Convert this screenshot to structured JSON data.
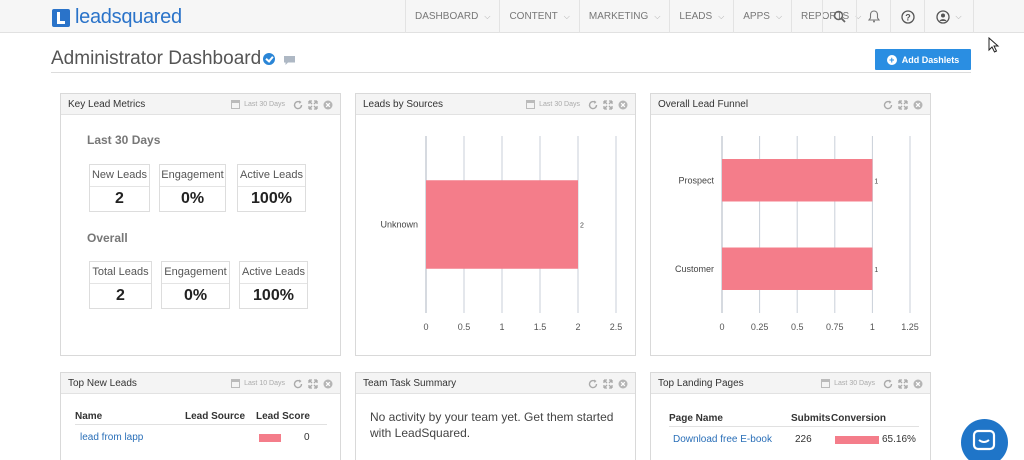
{
  "brand": {
    "name": "leadsquared"
  },
  "nav": {
    "items": [
      {
        "label": "DASHBOARD"
      },
      {
        "label": "CONTENT"
      },
      {
        "label": "MARKETING"
      },
      {
        "label": "LEADS"
      },
      {
        "label": "APPS"
      },
      {
        "label": "REPORTS"
      }
    ],
    "icons": [
      "search-icon",
      "bell-icon",
      "help-icon",
      "user-icon"
    ]
  },
  "page": {
    "title": "Administrator Dashboard",
    "add_button": "Add Dashlets"
  },
  "colors": {
    "accent": "#2a8ee2",
    "bar": "#f47d8a",
    "link": "#2a6fb8"
  },
  "dashlets": {
    "key_metrics": {
      "title": "Key Lead Metrics",
      "date": "Last 30 Days",
      "section1": {
        "heading": "Last 30 Days",
        "boxes": [
          {
            "label": "New Leads",
            "value": "2"
          },
          {
            "label": "Engagement",
            "value": "0%"
          },
          {
            "label": "Active Leads",
            "value": "100%"
          }
        ]
      },
      "section2": {
        "heading": "Overall",
        "boxes": [
          {
            "label": "Total Leads",
            "value": "2"
          },
          {
            "label": "Engagement",
            "value": "0%"
          },
          {
            "label": "Active Leads",
            "value": "100%"
          }
        ]
      }
    },
    "leads_by_sources": {
      "title": "Leads by Sources",
      "date": "Last 30 Days"
    },
    "lead_funnel": {
      "title": "Overall Lead Funnel"
    },
    "top_new_leads": {
      "title": "Top New Leads",
      "date": "Last 10 Days",
      "columns": [
        "Name",
        "Lead Source",
        "Lead Score"
      ],
      "rows": [
        {
          "name": "lead from lapp",
          "source": "",
          "score": "0",
          "score_fill": 0.9
        }
      ]
    },
    "team_task": {
      "title": "Team Task Summary",
      "message": "No activity by your team yet. Get them started with LeadSquared."
    },
    "landing_pages": {
      "title": "Top Landing Pages",
      "date": "Last 30 Days",
      "columns": [
        "Page Name",
        "Submits",
        "Conversion"
      ],
      "rows": [
        {
          "name": "Download free E-book",
          "submits": "226",
          "conversion": "65.16%",
          "conversion_value": 65.16
        }
      ]
    }
  },
  "chart_data": [
    {
      "type": "bar",
      "orientation": "horizontal",
      "categories": [
        "Unknown"
      ],
      "values": [
        2
      ],
      "data_labels": [
        "2"
      ],
      "xlim": [
        0,
        2.5
      ],
      "xticks": [
        "0",
        "0.5",
        "1",
        "1.5",
        "2",
        "2.5"
      ],
      "grid": true
    },
    {
      "type": "bar",
      "orientation": "horizontal",
      "categories": [
        "Prospect",
        "Customer"
      ],
      "values": [
        1,
        1
      ],
      "data_labels": [
        "1",
        "1"
      ],
      "xlim": [
        0,
        1.25
      ],
      "xticks": [
        "0",
        "0.25",
        "0.5",
        "0.75",
        "1",
        "1.25"
      ],
      "grid": true
    }
  ]
}
